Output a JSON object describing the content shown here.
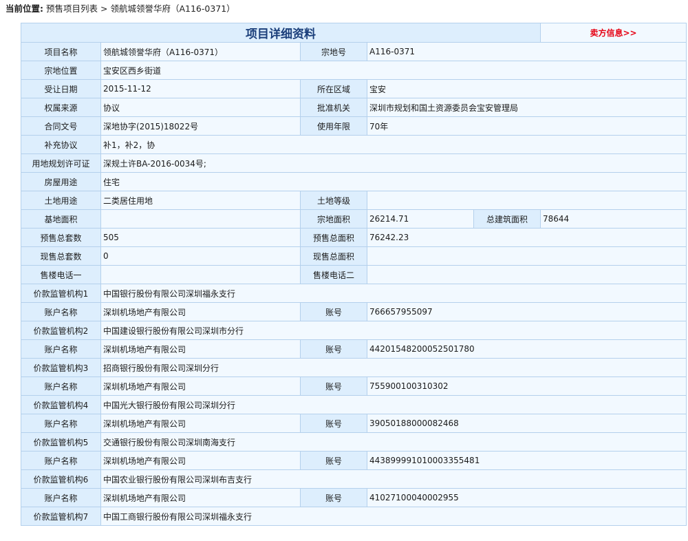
{
  "breadcrumb": {
    "label": "当前位置:",
    "list": "预售项目列表",
    "separator": ">",
    "current": "领航城领誉华府（A116-0371）"
  },
  "header": {
    "title": "项目详细资料",
    "seller_link": "卖方信息>>"
  },
  "project": {
    "name_label": "项目名称",
    "name": "领航城领誉华府（A116-0371）",
    "parcel_no_label": "宗地号",
    "parcel_no": "A116-0371",
    "location_label": "宗地位置",
    "location": "宝安区西乡街道",
    "transfer_date_label": "受让日期",
    "transfer_date": "2015-11-12",
    "district_label": "所在区域",
    "district": "宝安",
    "ownership_label": "权属来源",
    "ownership": "协议",
    "approval_label": "批准机关",
    "approval": "深圳市规划和国土资源委员会宝安管理局",
    "contract_label": "合同文号",
    "contract": "深地协字(2015)18022号",
    "term_label": "使用年限",
    "term": "70年",
    "supplement_label": "补充协议",
    "supplement": "补1，补2，协",
    "permit_label": "用地规划许可证",
    "permit": "深规土许BA-2016-0034号;",
    "house_use_label": "房屋用途",
    "house_use": "住宅",
    "land_use_label": "土地用途",
    "land_use": "二类居住用地",
    "land_grade_label": "土地等级",
    "land_grade": "",
    "base_area_label": "基地面积",
    "base_area": "",
    "parcel_area_label": "宗地面积",
    "parcel_area": "26214.71",
    "total_build_label": "总建筑面积",
    "total_build": "78644",
    "presale_units_label": "预售总套数",
    "presale_units": "505",
    "presale_area_label": "预售总面积",
    "presale_area": "76242.23",
    "spot_units_label": "现售总套数",
    "spot_units": "0",
    "spot_area_label": "现售总面积",
    "spot_area": "",
    "phone1_label": "售楼电话一",
    "phone1": "",
    "phone2_label": "售楼电话二",
    "phone2": ""
  },
  "account_name_label": "账户名称",
  "account_no_label": "账号",
  "supervisors": [
    {
      "label": "价款监管机构1",
      "bank": "中国银行股份有限公司深圳福永支行",
      "account_name": "深圳机场地产有限公司",
      "account_no": "766657955097"
    },
    {
      "label": "价款监管机构2",
      "bank": "中国建设银行股份有限公司深圳市分行",
      "account_name": "深圳机场地产有限公司",
      "account_no": "44201548200052501780"
    },
    {
      "label": "价款监管机构3",
      "bank": "招商银行股份有限公司深圳分行",
      "account_name": "深圳机场地产有限公司",
      "account_no": "755900100310302"
    },
    {
      "label": "价款监管机构4",
      "bank": "中国光大银行股份有限公司深圳分行",
      "account_name": "深圳机场地产有限公司",
      "account_no": "39050188000082468"
    },
    {
      "label": "价款监管机构5",
      "bank": "交通银行股份有限公司深圳南海支行",
      "account_name": "深圳机场地产有限公司",
      "account_no": "443899991010003355481"
    },
    {
      "label": "价款监管机构6",
      "bank": "中国农业银行股份有限公司深圳布吉支行",
      "account_name": "深圳机场地产有限公司",
      "account_no": "41027100040002955"
    },
    {
      "label": "价款监管机构7",
      "bank": "中国工商银行股份有限公司深圳福永支行"
    }
  ]
}
